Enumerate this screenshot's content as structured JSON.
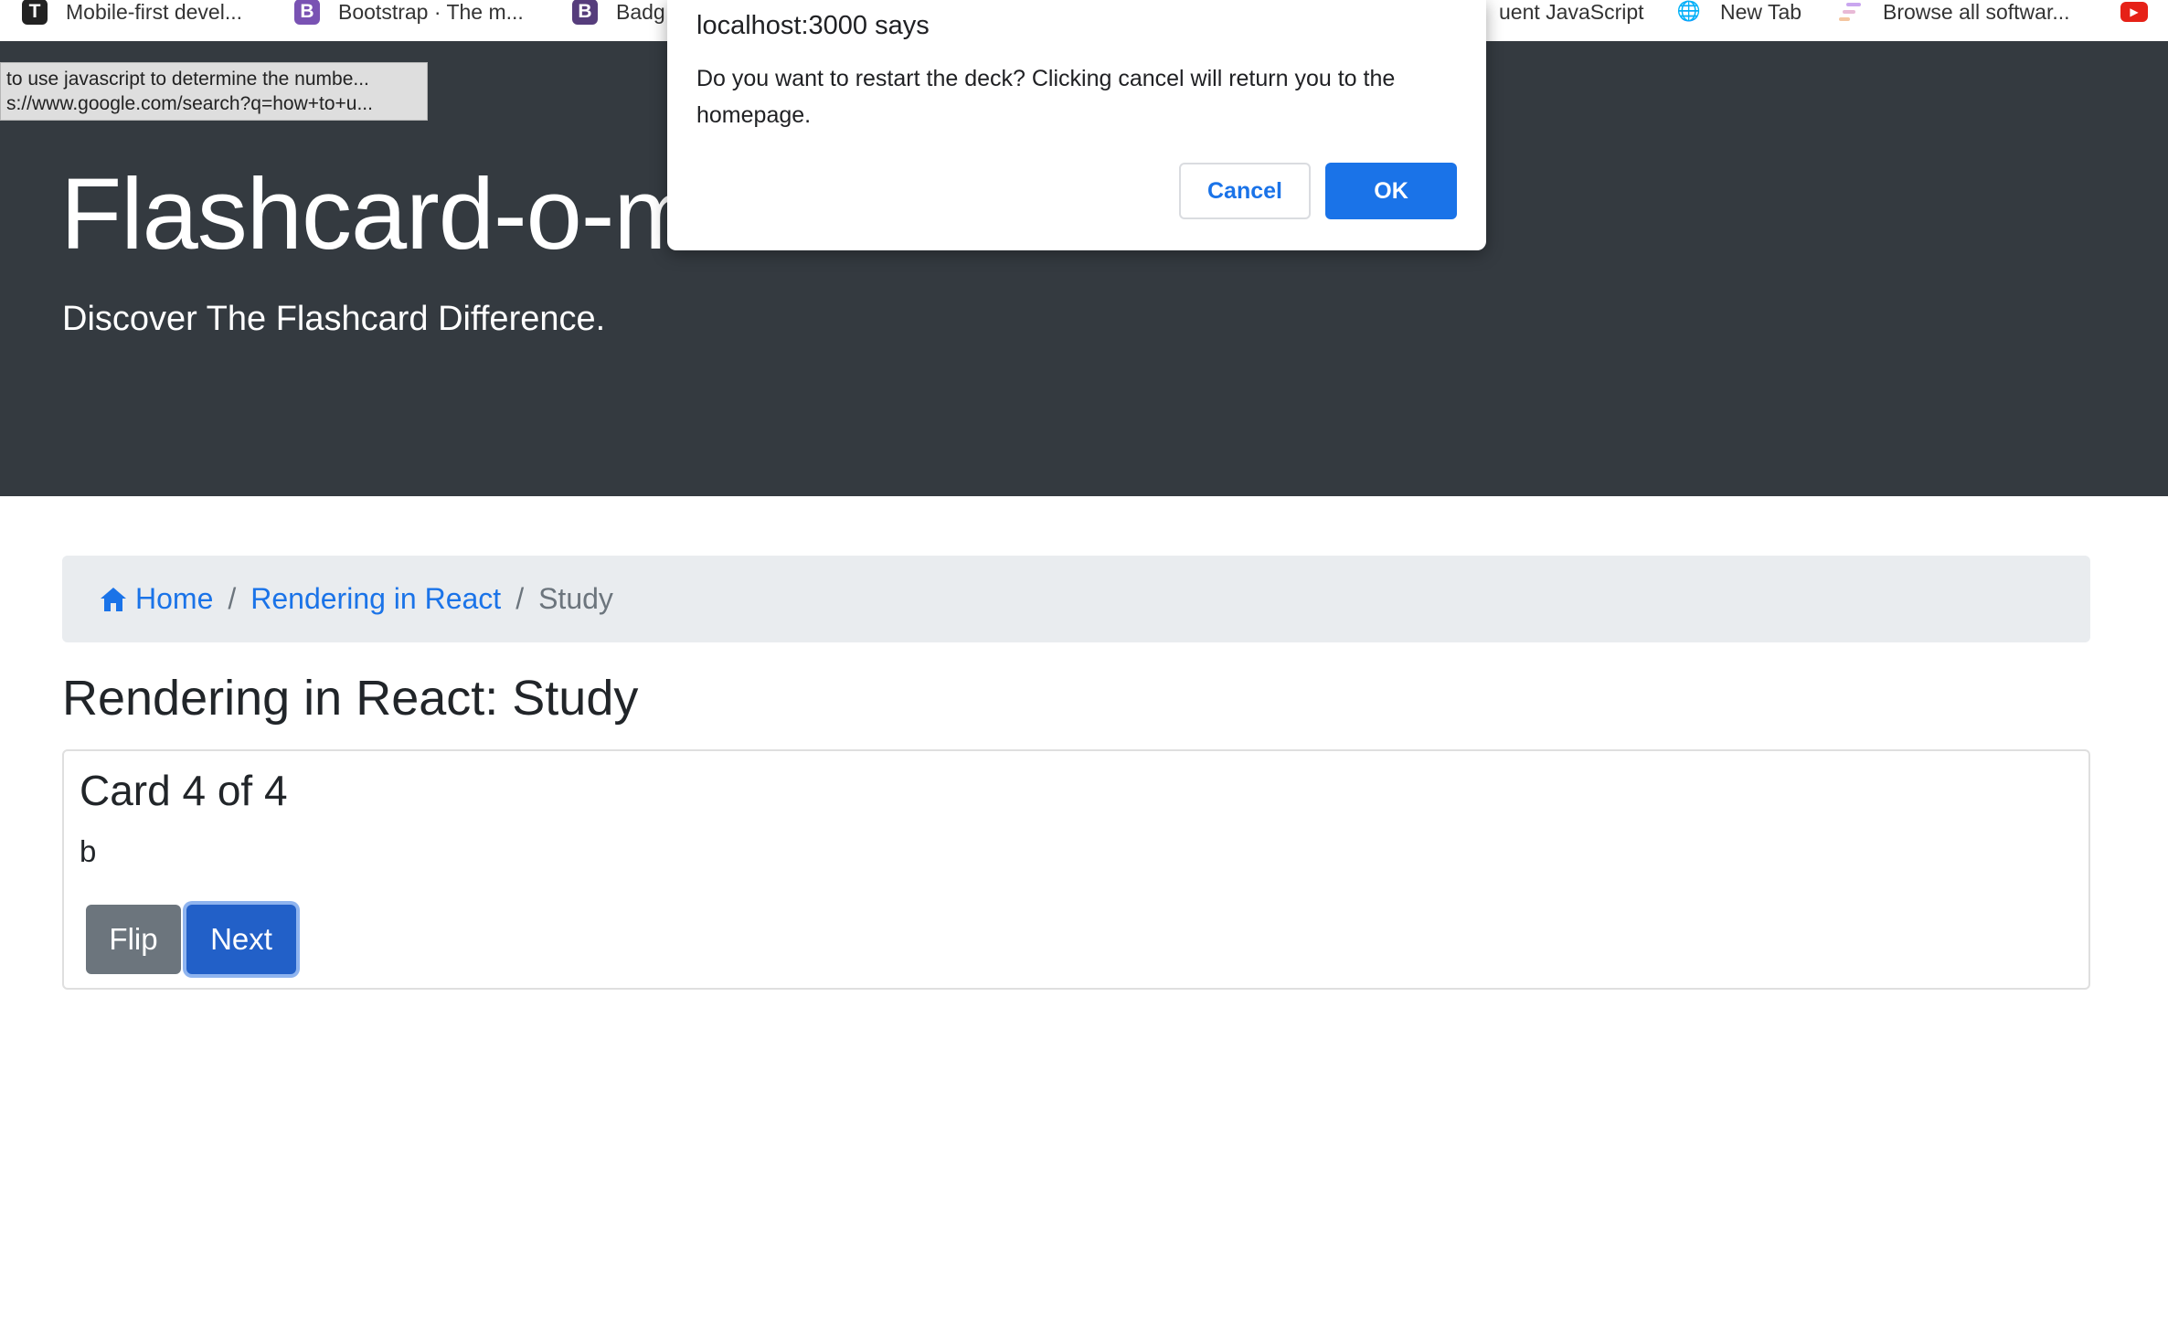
{
  "bookmarks": [
    {
      "label": "Mobile-first devel...",
      "icon": "t-icon",
      "glyph": "T"
    },
    {
      "label": "Bootstrap · The m...",
      "icon": "bootstrap-icon",
      "glyph": "B"
    },
    {
      "label": "Badg",
      "icon": "bootstrap-icon",
      "glyph": "B"
    },
    {
      "label": "uent JavaScript",
      "icon": "",
      "glyph": ""
    },
    {
      "label": "New Tab",
      "icon": "globe-icon",
      "glyph": "🌐"
    },
    {
      "label": "Browse all softwar...",
      "icon": "lines-icon",
      "glyph": "☰"
    },
    {
      "label": "",
      "icon": "youtube-icon",
      "glyph": "▶"
    }
  ],
  "status_tooltip": {
    "line1": "to use javascript to determine the numbe...",
    "line2": "s://www.google.com/search?q=how+to+u..."
  },
  "jumbotron": {
    "title": "Flashcard-o-matic",
    "lead": "Discover The Flashcard Difference."
  },
  "breadcrumb": {
    "home": "Home",
    "deck": "Rendering in React",
    "current": "Study",
    "separator": "/"
  },
  "page": {
    "heading": "Rendering in React: Study"
  },
  "card": {
    "title": "Card 4 of 4",
    "text": "b",
    "flip_label": "Flip",
    "next_label": "Next"
  },
  "dialog": {
    "title": "localhost:3000 says",
    "message": "Do you want to restart the deck? Clicking cancel will return you to the homepage.",
    "cancel_label": "Cancel",
    "ok_label": "OK"
  },
  "colors": {
    "jumbotron_bg": "#343a40",
    "link": "#1a73e8",
    "secondary_button": "#6c757d",
    "primary_button": "#2260c8"
  }
}
